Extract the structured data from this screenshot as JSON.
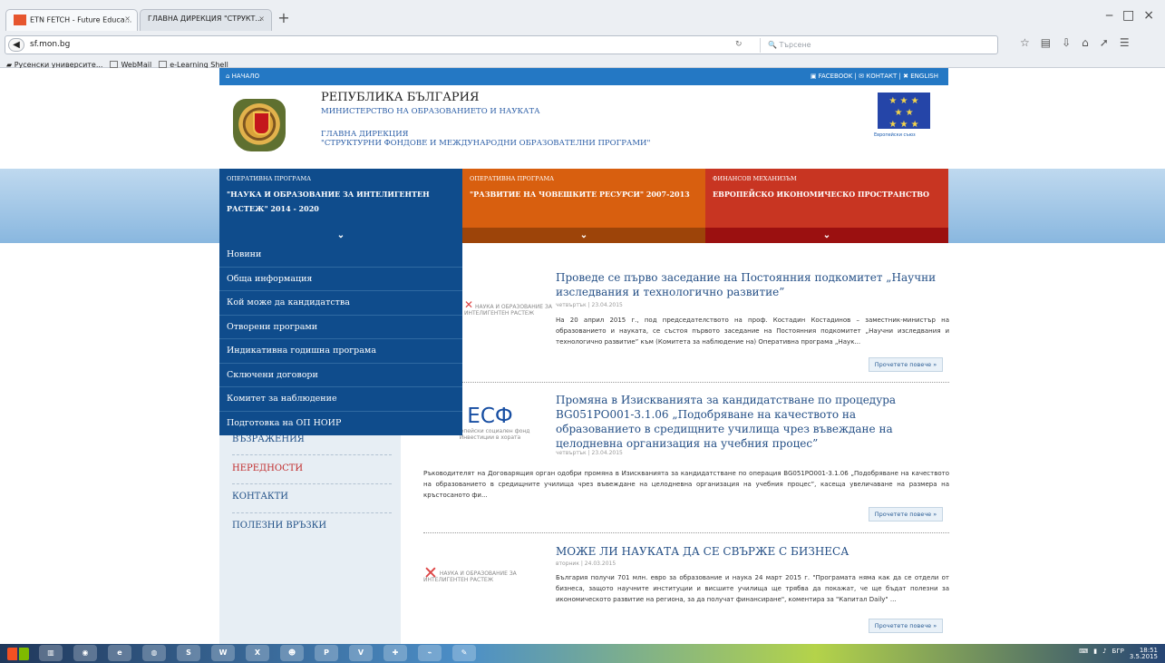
{
  "browser": {
    "tabs": [
      "ETN FETCH - Future Educa...",
      "ГЛАВНА ДИРЕКЦИЯ \"СТРУКТ..."
    ],
    "url": "sf.mon.bg",
    "search_placeholder": "Търсене",
    "bookmarks": [
      "Русенски университе...",
      "WebMail",
      "e-Learning Shell"
    ]
  },
  "topbar": {
    "home": "НАЧАЛО",
    "facebook": "FACEBOOK",
    "contact": "КОНТАКТ",
    "english": "ENGLISH"
  },
  "header": {
    "title": "РЕПУБЛИКА БЪЛГАРИЯ",
    "ministry": "МИНИСТЕРСТВО НА ОБРАЗОВАНИЕТО И НАУКАТА",
    "directorate": "ГЛАВНА ДИРЕКЦИЯ",
    "directorate_name": "\"СТРУКТУРНИ ФОНДОВЕ И МЕЖДУНАРОДНИ ОБРАЗОВАТЕЛНИ ПРОГРАМИ\"",
    "eu_label": "Европейски съюз"
  },
  "programs": [
    {
      "small": "ОПЕРАТИВНА ПРОГРАМА",
      "title": "\"НАУКА И ОБРАЗОВАНИЕ ЗА ИНТЕЛИГЕНТЕН РАСТЕЖ\" 2014 - 2020",
      "color": "#0f4c8c"
    },
    {
      "small": "ОПЕРАТИВНА ПРОГРАМА",
      "title": "\"РАЗВИТИЕ НА ЧОВЕШКИТЕ РЕСУРСИ\" 2007-2013",
      "color": "#d85f0f"
    },
    {
      "small": "ФИНАНСОВ МЕХАНИЗЪМ",
      "title": "ЕВРОПЕЙСКО ИКОНОМИЧЕСКО ПРОСТРАНСТВО",
      "color": "#c83522"
    }
  ],
  "dropdown": [
    "Новини",
    "Обща информация",
    "Кой може да кандидатства",
    "Отворени програми",
    "Индикативна годишна програма",
    "Сключени договори",
    "Комитет за наблюдение",
    "Подготовка на ОП НОИР"
  ],
  "sidebar": [
    "ВЪЗРАЖЕНИЯ",
    "НЕРЕДНОСТИ",
    "КОНТАКТИ",
    "ПОЛЕЗНИ ВРЪЗКИ"
  ],
  "news": [
    {
      "title": "Проведе се първо заседание на Постоянния подкомитет „Научни изследвания и технологично развитие”",
      "date": "четвъртък | 23.04.2015",
      "text": "На 20 април 2015 г., под председателството на проф. Костадин Костадинов – заместник-министър на образованието и науката, се състоя първото заседание на Постоянния подкомитет „Научни изследвания и технологично развитие” към (Комитета за наблюдение на) Оперативна програма „Наук...",
      "image": "НАУКА И ОБРАЗОВАНИЕ ЗА ИНТЕЛИГЕНТЕН РАСТЕЖ",
      "more": "Прочетете повече »"
    },
    {
      "title": "Промяна в Изискванията за кандидатстване по процедура BG051PO001-3.1.06 „Подобряване на качеството на образованието в средищните училища чрез въвеждане на целодневна организация на учебния процес”",
      "date": "четвъртък | 23.04.2015",
      "text": "Ръководителят на Договарящия орган одобри промяна в Изискванията за кандидатстване по операция BG051PO001-3.1.06 „Подобряване на качеството на образованието в средищните училища чрез въвеждане на целодневна организация на учебния процес”, касеща увеличаване на размера на кръстосаното фи...",
      "image": "ЕСФ",
      "image_caption": "Европейски социален фонд Инвестиции в хората",
      "more": "Прочетете повече »"
    },
    {
      "title": "МОЖЕ ЛИ НАУКАТА ДА СЕ СВЪРЖЕ С БИЗНЕСА",
      "date": "вторник | 24.03.2015",
      "text": "България получи 701 млн. евро за образование и наука 24 март 2015 г. \"Програмата няма как да се отдели от бизнеса, защото научните институции и висшите училища ще трябва да покажат, че ще бъдат полезни за икономическото развитие на региона, за да получат финансиране\", коментира за \"Капитал Daily\" ...",
      "image": "НАУКА И ОБРАЗОВАНИЕ ЗА ИНТЕЛИГЕНТЕН РАСТЕЖ",
      "more": "Прочетете повече »"
    }
  ],
  "taskbar": {
    "language": "БГР",
    "time": "18:51",
    "date": "3.5.2015"
  }
}
